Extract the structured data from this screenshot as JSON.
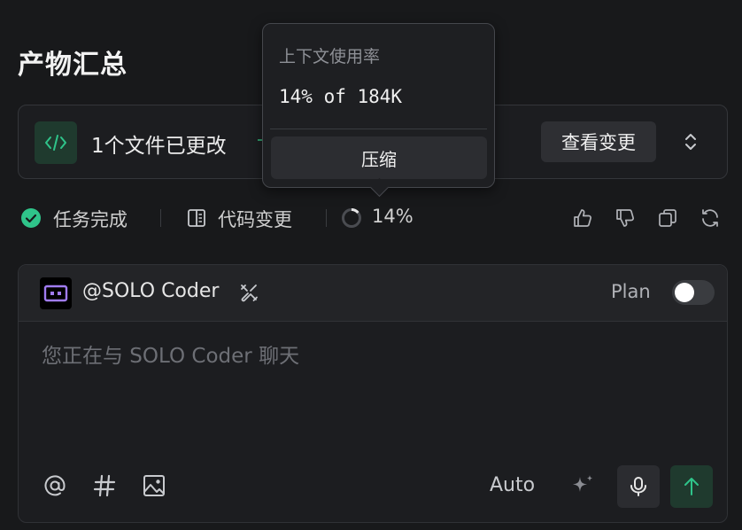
{
  "page": {
    "title": "产物汇总"
  },
  "changes": {
    "summary": "1个文件已更改",
    "view_button": "查看变更"
  },
  "status": {
    "task_label": "任务完成",
    "diff_label": "代码变更",
    "context_percent": "14%",
    "context_fraction": 0.14
  },
  "tooltip": {
    "title": "上下文使用率",
    "usage": "14% of 184K",
    "compress_button": "压缩"
  },
  "composer": {
    "agent_name": "@SOLO Coder",
    "plan_label": "Plan",
    "plan_enabled": false,
    "placeholder": "您正在与 SOLO Coder 聊天",
    "model_label": "Auto"
  },
  "colors": {
    "accent_green": "#2fc48a",
    "send_bg": "#1f3a2e",
    "agent_avatar": "#a07cf0"
  },
  "icons": {
    "code": "code-icon",
    "expand": "chevron-up-down-icon",
    "done": "check-circle-icon",
    "diff": "file-diff-icon",
    "usage": "progress-ring-icon",
    "like": "thumbs-up-icon",
    "dislike": "thumbs-down-icon",
    "copy": "copy-icon",
    "regenerate": "refresh-icon",
    "tools": "tools-icon",
    "mention": "at-icon",
    "hash": "hash-icon",
    "image": "image-icon",
    "sparkle": "sparkle-icon",
    "mic": "mic-icon",
    "send": "arrow-up-icon"
  }
}
